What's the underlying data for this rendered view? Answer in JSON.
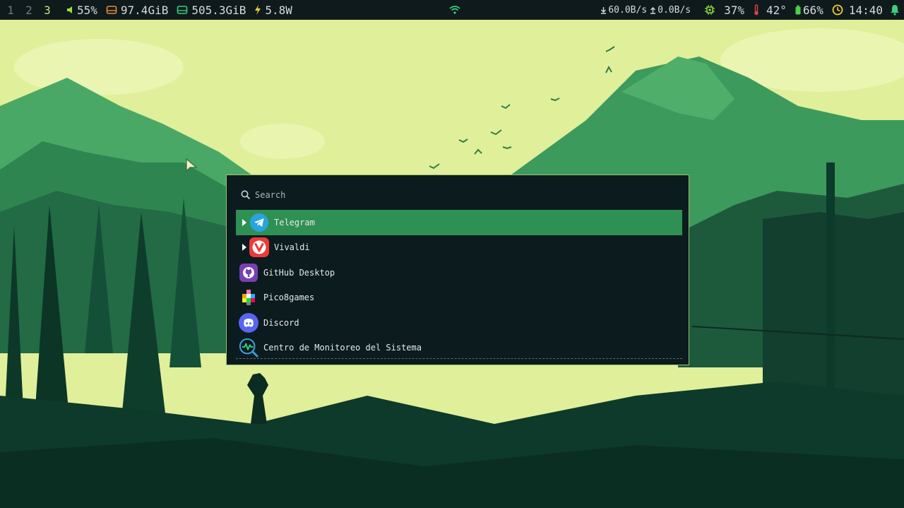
{
  "topbar": {
    "workspaces": [
      "1",
      "2",
      "3"
    ],
    "active_workspace": "3",
    "volume": "55%",
    "disk_root": "97.4GiB",
    "disk_home": "505.3GiB",
    "power": "5.8W",
    "net_down": "60.0B/s",
    "net_up": "0.0B/s",
    "cpu": "37%",
    "temp": "42°",
    "battery": "66%",
    "clock": "14:40",
    "colors": {
      "volume_icon": "#9be13a",
      "disk_root_icon": "#e68a3a",
      "disk_home_icon": "#3ad07a",
      "power_icon": "#f1d12b",
      "cpu_icon": "#8de03a",
      "temp_icon": "#e04040",
      "battery_icon": "#4cd04a",
      "clock_icon": "#f1d12b",
      "bell_icon": "#3ad07a"
    }
  },
  "launcher": {
    "search_placeholder": "Search",
    "items": [
      {
        "label": "Telegram",
        "icon": "telegram-icon",
        "has_submenu": true,
        "selected": true
      },
      {
        "label": "Vivaldi",
        "icon": "vivaldi-icon",
        "has_submenu": true,
        "selected": false
      },
      {
        "label": "GitHub Desktop",
        "icon": "github-desktop-icon",
        "has_submenu": false,
        "selected": false
      },
      {
        "label": "Pico8games",
        "icon": "pico8-icon",
        "has_submenu": false,
        "selected": false
      },
      {
        "label": "Discord",
        "icon": "discord-icon",
        "has_submenu": false,
        "selected": false
      },
      {
        "label": "Centro de Monitoreo del Sistema",
        "icon": "system-monitor-icon",
        "has_submenu": false,
        "selected": false
      }
    ]
  }
}
